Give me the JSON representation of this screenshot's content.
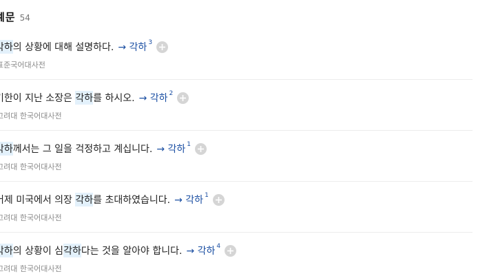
{
  "header": {
    "title": "예문",
    "count": "54"
  },
  "examples": [
    {
      "segments": [
        {
          "text": "각하",
          "hl": true
        },
        {
          "text": "의 상황에 대해 설명하다.",
          "hl": false
        }
      ],
      "link": "→ 각하",
      "sup": "3",
      "source": "표준국어대사전"
    },
    {
      "segments": [
        {
          "text": "기한이 지난 소장은 ",
          "hl": false
        },
        {
          "text": "각하",
          "hl": true
        },
        {
          "text": "를 하시오.",
          "hl": false
        }
      ],
      "link": "→ 각하",
      "sup": "2",
      "source": "고려대 한국어대사전"
    },
    {
      "segments": [
        {
          "text": "각하",
          "hl": true
        },
        {
          "text": "께서는 그 일을 걱정하고 계십니다.",
          "hl": false
        }
      ],
      "link": "→ 각하",
      "sup": "1",
      "source": "고려대 한국어대사전"
    },
    {
      "segments": [
        {
          "text": "어제 미국에서 의장 ",
          "hl": false
        },
        {
          "text": "각하",
          "hl": true
        },
        {
          "text": "를 초대하였습니다.",
          "hl": false
        }
      ],
      "link": "→ 각하",
      "sup": "1",
      "source": "고려대 한국어대사전"
    },
    {
      "segments": [
        {
          "text": "각하",
          "hl": true
        },
        {
          "text": "의 상황이 심",
          "hl": false
        },
        {
          "text": "각하",
          "hl": true
        },
        {
          "text": "다는 것을 알아야 합니다.",
          "hl": false
        }
      ],
      "link": "→ 각하",
      "sup": "4",
      "source": "고려대 한국어대사전"
    }
  ],
  "colors": {
    "link": "#1a4ea2",
    "highlight": "#e3f1fb",
    "source_text": "#8a8a8a"
  },
  "icons": {
    "add": "plus-circle-icon"
  }
}
